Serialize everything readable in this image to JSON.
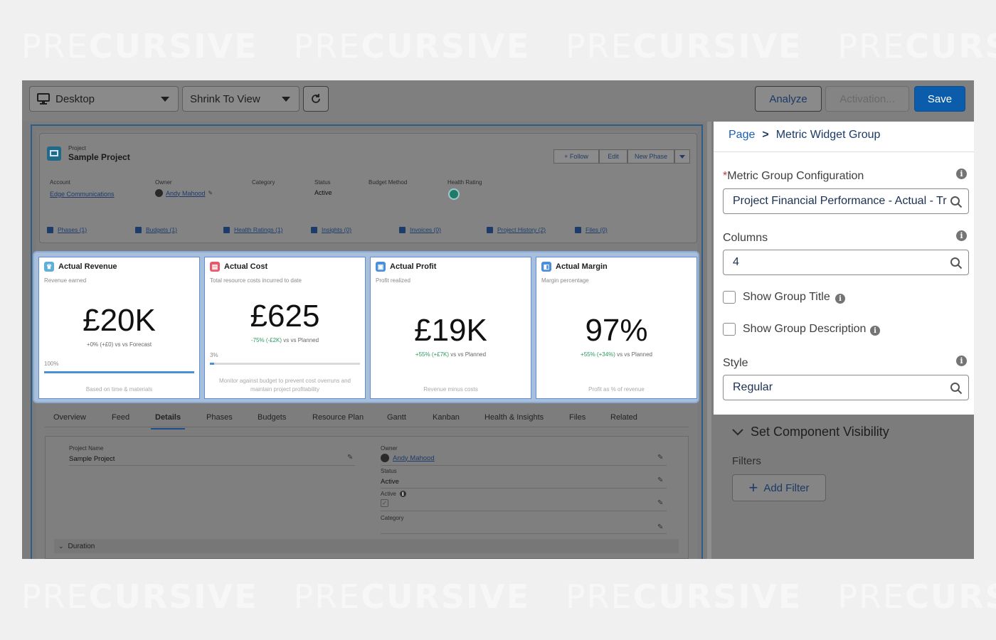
{
  "watermark": {
    "light": "PRE",
    "bold": "CURSIVE"
  },
  "toolbar": {
    "device_label": "Desktop",
    "view_label": "Shrink To View",
    "analyze_label": "Analyze",
    "activation_label": "Activation...",
    "save_label": "Save"
  },
  "record": {
    "object_label": "Project",
    "name": "Sample Project",
    "actions": {
      "follow": "+ Follow",
      "edit": "Edit",
      "new_phase": "New Phase"
    },
    "fields": [
      {
        "label": "Account",
        "value": "Edge Communications"
      },
      {
        "label": "Owner",
        "value": "Andy Mahood"
      },
      {
        "label": "Category",
        "value": ""
      },
      {
        "label": "Status",
        "value": "Active"
      },
      {
        "label": "Budget Method",
        "value": ""
      },
      {
        "label": "Health Rating",
        "value": ""
      }
    ],
    "related": [
      "Phases (1)",
      "Budgets (1)",
      "Health Ratings (1)",
      "Insights (0)",
      "Invoices (0)",
      "Project History (2)",
      "Files (0)"
    ]
  },
  "metrics": [
    {
      "title": "Actual Revenue",
      "subtitle": "Revenue earned",
      "value": "£20K",
      "comparison_change": "+0% (+£0)",
      "comparison_text": " vs vs Forecast",
      "progress_label": "100%",
      "progress": 1.0,
      "footer": "Based on time & materials",
      "icon_color": "#5fb0d8"
    },
    {
      "title": "Actual Cost",
      "subtitle": "Total resource costs incurred to date",
      "value": "£625",
      "comparison_change": "-75% (-£2K)",
      "comparison_text": " vs vs Planned",
      "progress_label": "3%",
      "progress": 0.03,
      "footer": "Monitor against budget to prevent cost overruns and maintain project profitability",
      "icon_color": "#e55a6b"
    },
    {
      "title": "Actual Profit",
      "subtitle": "Profit realized",
      "value": "£19K",
      "comparison_change": "+55% (+£7K)",
      "comparison_text": " vs vs Planned",
      "progress_label": "",
      "progress": null,
      "footer": "Revenue minus costs",
      "icon_color": "#4b8fd8"
    },
    {
      "title": "Actual Margin",
      "subtitle": "Margin percentage",
      "value": "97%",
      "comparison_change": "+55% (+34%)",
      "comparison_text": " vs vs Planned",
      "progress_label": "",
      "progress": null,
      "footer": "Profit as % of revenue",
      "icon_color": "#4b8fd8"
    }
  ],
  "tabs": [
    "Overview",
    "Feed",
    "Details",
    "Phases",
    "Budgets",
    "Resource Plan",
    "Gantt",
    "Kanban",
    "Health & Insights",
    "Files",
    "Related"
  ],
  "active_tab": "Details",
  "details": {
    "project_name_label": "Project Name",
    "project_name_value": "Sample Project",
    "owner_label": "Owner",
    "owner_value": "Andy Mahood",
    "status_label": "Status",
    "status_value": "Active",
    "active_label": "Active",
    "category_label": "Category",
    "section_label": "Duration"
  },
  "panel": {
    "breadcrumb_root": "Page",
    "breadcrumb_sep": ">",
    "breadcrumb_current": "Metric Widget Group",
    "required_mark": "*",
    "config_label": "Metric Group Configuration",
    "config_value": "Project Financial Performance - Actual - Tr",
    "columns_label": "Columns",
    "columns_value": "4",
    "show_title_label": "Show Group Title",
    "show_desc_label": "Show Group Description",
    "style_label": "Style",
    "style_value": "Regular",
    "visibility_label": "Set Component Visibility",
    "filters_label": "Filters",
    "add_filter_label": "Add Filter"
  },
  "colors": {
    "accent": "#1b5fb0",
    "save_bg": "#0b5cab",
    "positive": "#2a9a5c"
  }
}
